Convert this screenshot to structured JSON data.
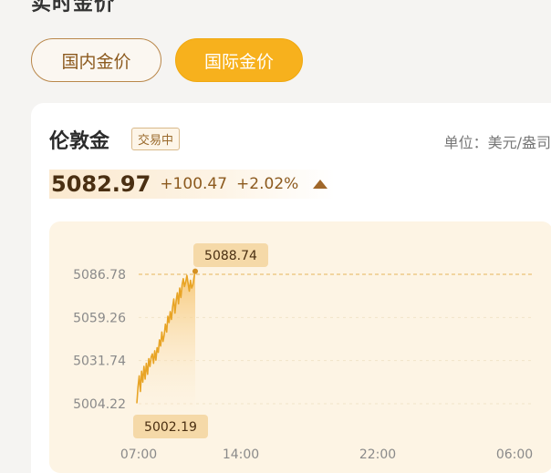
{
  "page": {
    "title": "实时金价"
  },
  "tabs": [
    {
      "label": "国内金价",
      "active": false
    },
    {
      "label": "国际金价",
      "active": true
    }
  ],
  "quote": {
    "name": "伦敦金",
    "status": "交易中",
    "unit": "单位：美元/盎司",
    "price": "5082.97",
    "change": "+100.47",
    "change_pct": "+2.02%",
    "direction_icon": "triangle-up-icon"
  },
  "colors": {
    "accent": "#f7b11d",
    "line": "#e8a425",
    "text_brown": "#8c5a1e"
  },
  "chart_data": {
    "type": "line",
    "y_ticks": [
      "5086.78",
      "5059.26",
      "5031.74",
      "5004.22"
    ],
    "x_ticks": [
      "07:00",
      "14:00",
      "22:00",
      "06:00"
    ],
    "ylim": [
      5004.22,
      5086.78
    ],
    "series": [
      {
        "values": [
          5004.5,
          5015,
          5022,
          5012,
          5025,
          5018,
          5028,
          5020,
          5030,
          5023,
          5033,
          5028,
          5034,
          5036,
          5030,
          5038,
          5032,
          5040,
          5037,
          5045,
          5041,
          5050,
          5044,
          5048,
          5055,
          5050,
          5060,
          5056,
          5063,
          5058,
          5066,
          5071,
          5062,
          5070,
          5075,
          5068,
          5078,
          5072,
          5080,
          5084,
          5079,
          5082,
          5086,
          5081,
          5076,
          5083,
          5078,
          5080,
          5085,
          5088.74
        ]
      }
    ],
    "high_label": "5088.74",
    "low_label": "5002.19",
    "reference_value": 5086.78
  }
}
